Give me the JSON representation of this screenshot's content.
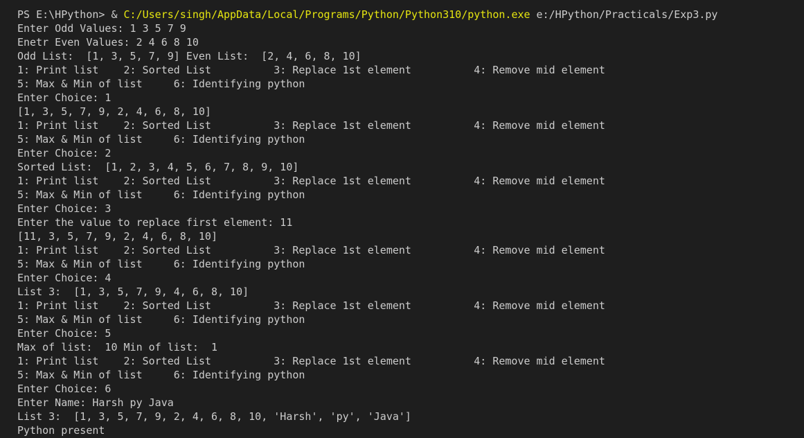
{
  "colors": {
    "background": "#1e1e1e",
    "text": "#cccccc",
    "executable_path": "#e5e510"
  },
  "terminal": {
    "prompt": {
      "prefix": "PS E:\\HPython> & ",
      "executable": "C:/Users/singh/AppData/Local/Programs/Python/Python310/python.exe",
      "script": " e:/HPython/Practicals/Exp3.py"
    },
    "lines": [
      "Enter Odd Values: 1 3 5 7 9",
      "Enetr Even Values: 2 4 6 8 10",
      "Odd List:  [1, 3, 5, 7, 9] Even List:  [2, 4, 6, 8, 10]",
      "1: Print list    2: Sorted List          3: Replace 1st element          4: Remove mid element",
      "5: Max & Min of list     6: Identifying python",
      "Enter Choice: 1",
      "[1, 3, 5, 7, 9, 2, 4, 6, 8, 10]",
      "1: Print list    2: Sorted List          3: Replace 1st element          4: Remove mid element",
      "5: Max & Min of list     6: Identifying python",
      "Enter Choice: 2",
      "Sorted List:  [1, 2, 3, 4, 5, 6, 7, 8, 9, 10]",
      "1: Print list    2: Sorted List          3: Replace 1st element          4: Remove mid element",
      "5: Max & Min of list     6: Identifying python",
      "Enter Choice: 3",
      "Enter the value to replace first element: 11",
      "[11, 3, 5, 7, 9, 2, 4, 6, 8, 10]",
      "1: Print list    2: Sorted List          3: Replace 1st element          4: Remove mid element",
      "5: Max & Min of list     6: Identifying python",
      "Enter Choice: 4",
      "List 3:  [1, 3, 5, 7, 9, 4, 6, 8, 10]",
      "1: Print list    2: Sorted List          3: Replace 1st element          4: Remove mid element",
      "5: Max & Min of list     6: Identifying python",
      "Enter Choice: 5",
      "Max of list:  10 Min of list:  1",
      "1: Print list    2: Sorted List          3: Replace 1st element          4: Remove mid element",
      "5: Max & Min of list     6: Identifying python",
      "Enter Choice: 6",
      "Enter Name: Harsh py Java",
      "List 3:  [1, 3, 5, 7, 9, 2, 4, 6, 8, 10, 'Harsh', 'py', 'Java']",
      "Python present"
    ]
  }
}
